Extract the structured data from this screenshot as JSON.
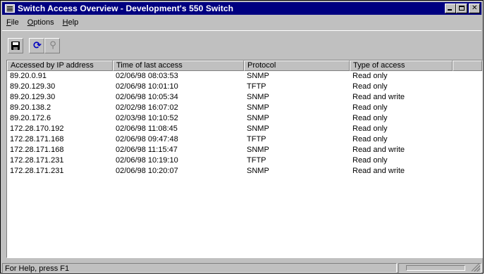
{
  "window": {
    "title": "Switch Access Overview - Development's 550 Switch"
  },
  "menu": [
    {
      "label": "File"
    },
    {
      "label": "Options"
    },
    {
      "label": "Help"
    }
  ],
  "toolbar": {
    "buttons": [
      {
        "icon": "save-icon"
      },
      {
        "icon": "refresh-icon"
      },
      {
        "icon": "find-icon"
      }
    ]
  },
  "table": {
    "columns": [
      "Accessed by IP address",
      "Time of last access",
      "Protocol",
      "Type of access",
      ""
    ],
    "rows": [
      [
        "89.20.0.91",
        "02/06/98 08:03:53",
        "SNMP",
        "Read only"
      ],
      [
        "89.20.129.30",
        "02/06/98 10:01:10",
        "TFTP",
        "Read only"
      ],
      [
        "89.20.129.30",
        "02/06/98 10:05:34",
        "SNMP",
        "Read and write"
      ],
      [
        "89.20.138.2",
        "02/02/98 16:07:02",
        "SNMP",
        "Read only"
      ],
      [
        "89.20.172.6",
        "02/03/98 10:10:52",
        "SNMP",
        "Read only"
      ],
      [
        "172.28.170.192",
        "02/06/98 11:08:45",
        "SNMP",
        "Read only"
      ],
      [
        "172.28.171.168",
        "02/06/98 09:47:48",
        "TFTP",
        "Read only"
      ],
      [
        "172.28.171.168",
        "02/06/98 11:15:47",
        "SNMP",
        "Read and write"
      ],
      [
        "172.28.171.231",
        "02/06/98 10:19:10",
        "TFTP",
        "Read only"
      ],
      [
        "172.28.171.231",
        "02/06/98 10:20:07",
        "SNMP",
        "Read and write"
      ]
    ]
  },
  "statusbar": {
    "text": "For Help, press F1"
  }
}
